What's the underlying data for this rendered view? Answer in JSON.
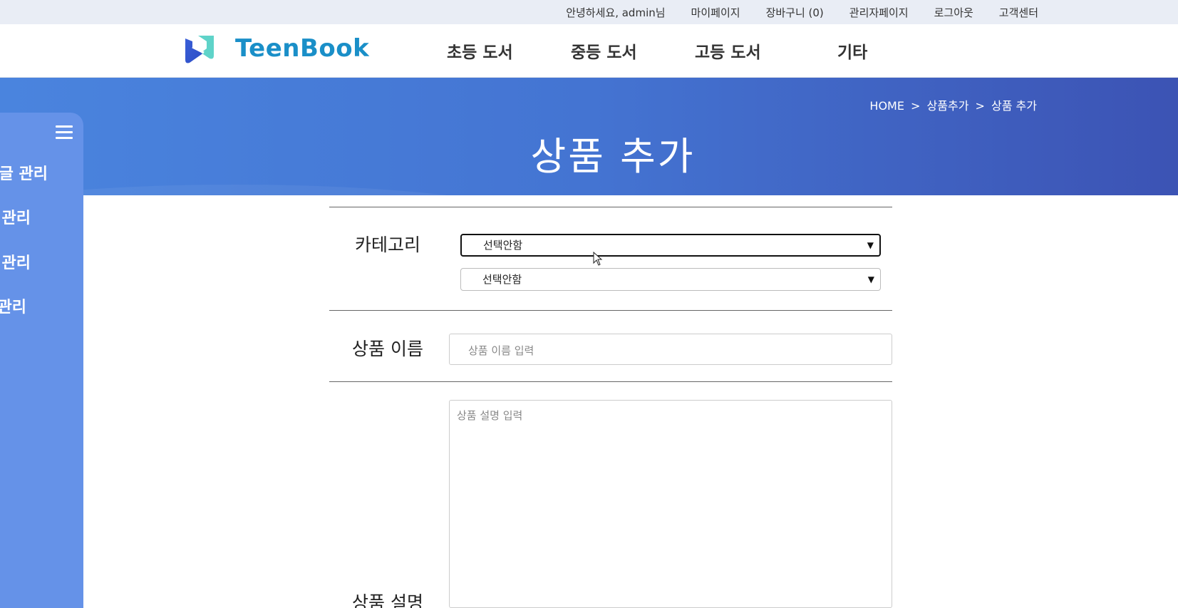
{
  "topbar": {
    "greeting": "안녕하세요, admin님",
    "mypage": "마이페이지",
    "cart": "장바구니 (0)",
    "admin": "관리자페이지",
    "logout": "로그아웃",
    "support": "고객센터"
  },
  "header": {
    "logo_text": "TeenBook",
    "nav": [
      "초등 도서",
      "중등 도서",
      "고등 도서",
      "기타"
    ]
  },
  "banner": {
    "breadcrumb": [
      "HOME",
      ">",
      "상품추가",
      ">",
      "상품 추가"
    ],
    "title": "상품 추가"
  },
  "sidebar": {
    "menu_icon": "hamburger-icon",
    "items": [
      "글 관리",
      "관리",
      "관리",
      "관리"
    ]
  },
  "form": {
    "category_label": "카테고리",
    "category_select1": "선택안함",
    "category_select2": "선택안함",
    "name_label": "상품 이름",
    "name_placeholder": "상품 이름 입력",
    "desc_label": "상품 설명",
    "desc_placeholder": "상품 설명 입력"
  },
  "colors": {
    "banner_start": "#4a84de",
    "banner_end": "#3c53b4",
    "sidebar": "#6592e8",
    "logo_text": "#1a8fc8",
    "topbar": "#e9edf5"
  }
}
